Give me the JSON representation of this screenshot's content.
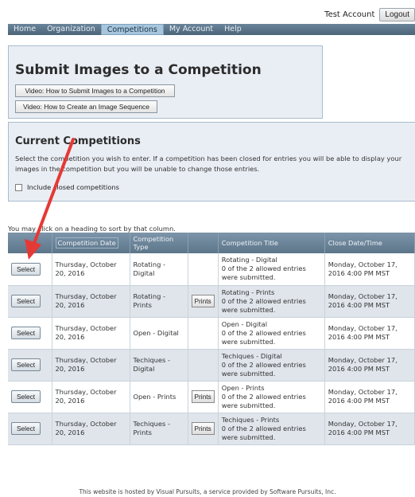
{
  "topbar": {
    "user": "Test Account",
    "logout": "Logout"
  },
  "nav": [
    {
      "label": "Home",
      "active": false
    },
    {
      "label": "Organization",
      "active": false
    },
    {
      "label": "Competitions",
      "active": true
    },
    {
      "label": "My Account",
      "active": false
    },
    {
      "label": "Help",
      "active": false
    }
  ],
  "submit": {
    "title": "Submit Images to a Competition",
    "video1": "Video: How to Submit Images to a Competition",
    "video2": "Video: How to Create an Image Sequence"
  },
  "current": {
    "title": "Current Competitions",
    "description": "Select the competition you wish to enter. If a competition has been closed for entries you will be able to display your images in the competition but you will be unable to change those entries.",
    "include_closed": "Include closed competitions"
  },
  "table": {
    "hint": "You may click on a heading to sort by that column.",
    "headers": [
      "",
      "Competition Date",
      "Competition Type",
      "",
      "Competition Title",
      "Close Date/Time"
    ],
    "select_label": "Select",
    "prints_label": "Prints",
    "rows": [
      {
        "date": "Thursday, October 20, 2016",
        "type": "Rotating - Digital",
        "prints": false,
        "title": "Rotating - Digital",
        "entries": "0 of the 2 allowed entries were submitted.",
        "close": "Monday, October 17, 2016 4:00 PM MST"
      },
      {
        "date": "Thursday, October 20, 2016",
        "type": "Rotating - Prints",
        "prints": true,
        "title": "Rotating - Prints",
        "entries": "0 of the 2 allowed entries were submitted.",
        "close": "Monday, October 17, 2016 4:00 PM MST"
      },
      {
        "date": "Thursday, October 20, 2016",
        "type": "Open - Digital",
        "prints": false,
        "title": "Open - Digital",
        "entries": "0 of the 2 allowed entries were submitted.",
        "close": "Monday, October 17, 2016 4:00 PM MST"
      },
      {
        "date": "Thursday, October 20, 2016",
        "type": "Techiques - Digital",
        "prints": false,
        "title": "Techiques - Digital",
        "entries": "0 of the 2 allowed entries were submitted.",
        "close": "Monday, October 17, 2016 4:00 PM MST"
      },
      {
        "date": "Thursday, October 20, 2016",
        "type": "Open - Prints",
        "prints": true,
        "title": "Open - Prints",
        "entries": "0 of the 2 allowed entries were submitted.",
        "close": "Monday, October 17, 2016 4:00 PM MST"
      },
      {
        "date": "Thursday, October 20, 2016",
        "type": "Techiques - Prints",
        "prints": true,
        "title": "Techiques - Prints",
        "entries": "0 of the 2 allowed entries were submitted.",
        "close": "Monday, October 17, 2016 4:00 PM MST"
      }
    ]
  },
  "footer": "This website is hosted by Visual Pursuits, a service provided by Software Pursuits, Inc.",
  "colors": {
    "nav_bar": "#4b6478",
    "nav_active": "#a7c5dc",
    "panel_bg": "#e9eef4",
    "row_alt": "#dfe5eb",
    "arrow": "#e53935"
  }
}
